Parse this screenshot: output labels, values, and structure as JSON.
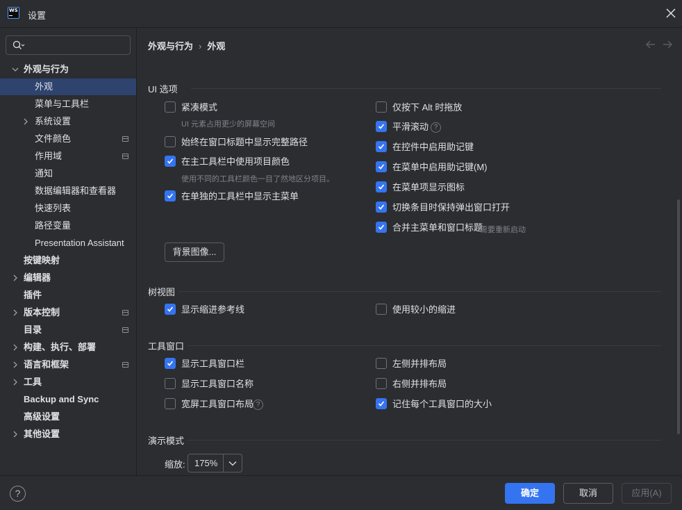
{
  "window": {
    "title": "设置",
    "logo_text": "WS"
  },
  "search": {
    "placeholder": ""
  },
  "sidebar": {
    "items": [
      {
        "label": "外观与行为",
        "bold": true,
        "expanded": true,
        "level": 0
      },
      {
        "label": "外观",
        "level": 1,
        "selected": true
      },
      {
        "label": "菜单与工具栏",
        "level": 1
      },
      {
        "label": "系统设置",
        "level": 1,
        "collapsible": true
      },
      {
        "label": "文件颜色",
        "level": 1,
        "project_icon": true
      },
      {
        "label": "作用域",
        "level": 1,
        "project_icon": true
      },
      {
        "label": "通知",
        "level": 1
      },
      {
        "label": "数据编辑器和查看器",
        "level": 1
      },
      {
        "label": "快速列表",
        "level": 1
      },
      {
        "label": "路径变量",
        "level": 1
      },
      {
        "label": "Presentation Assistant",
        "level": 1
      },
      {
        "label": "按键映射",
        "bold": true,
        "level": 0
      },
      {
        "label": "编辑器",
        "bold": true,
        "level": 0,
        "collapsible": true
      },
      {
        "label": "插件",
        "bold": true,
        "level": 0
      },
      {
        "label": "版本控制",
        "bold": true,
        "level": 0,
        "collapsible": true,
        "project_icon": true
      },
      {
        "label": "目录",
        "bold": true,
        "level": 0,
        "project_icon": true
      },
      {
        "label": "构建、执行、部署",
        "bold": true,
        "level": 0,
        "collapsible": true
      },
      {
        "label": "语言和框架",
        "bold": true,
        "level": 0,
        "collapsible": true,
        "project_icon": true
      },
      {
        "label": "工具",
        "bold": true,
        "level": 0,
        "collapsible": true
      },
      {
        "label": "Backup and Sync",
        "bold": true,
        "level": 0
      },
      {
        "label": "高级设置",
        "bold": true,
        "level": 0
      },
      {
        "label": "其他设置",
        "bold": true,
        "level": 0,
        "collapsible": true
      }
    ]
  },
  "breadcrumb": {
    "parent": "外观与行为",
    "separator": "›",
    "current": "外观"
  },
  "sections": {
    "ui_options": {
      "title": "UI 选项",
      "compact_mode": {
        "label": "紧凑模式",
        "checked": false,
        "hint": "UI 元素占用更少的屏幕空间"
      },
      "full_path_title": {
        "label": "始终在窗口标题中显示完整路径",
        "checked": false
      },
      "project_colors": {
        "label": "在主工具栏中使用项目颜色",
        "checked": true,
        "hint": "使用不同的工具栏颜色一目了然地区分项目。"
      },
      "separate_main_menu": {
        "label": "在单独的工具栏中显示主菜单",
        "checked": true
      },
      "alt_drag": {
        "label": "仅按下 Alt 时拖放",
        "checked": false
      },
      "smooth_scroll": {
        "label": "平滑滚动",
        "checked": true
      },
      "mnemonics_controls": {
        "label": "在控件中启用助记键",
        "checked": true
      },
      "mnemonics_menu": {
        "label": "在菜单中启用助记键(M)",
        "checked": true
      },
      "menu_icons": {
        "label": "在菜单项显示图标",
        "checked": true
      },
      "keep_popup": {
        "label": "切换条目时保持弹出窗口打开",
        "checked": true
      },
      "merge_menu": {
        "label": "合并主菜单和窗口标题",
        "checked": true,
        "hint": "需要重新启动"
      },
      "background_button": "背景图像..."
    },
    "tree_view": {
      "title": "树视图",
      "indent_guides": {
        "label": "显示缩进参考线",
        "checked": true
      },
      "smaller_indent": {
        "label": "使用较小的缩进",
        "checked": false
      }
    },
    "tool_windows": {
      "title": "工具窗口",
      "show_bar": {
        "label": "显示工具窗口栏",
        "checked": true
      },
      "show_names": {
        "label": "显示工具窗口名称",
        "checked": false
      },
      "widescreen": {
        "label": "宽屏工具窗口布局",
        "checked": false
      },
      "left_side": {
        "label": "左侧并排布局",
        "checked": false
      },
      "right_side": {
        "label": "右侧并排布局",
        "checked": false
      },
      "remember_size": {
        "label": "记住每个工具窗口的大小",
        "checked": true
      }
    },
    "presentation": {
      "title": "演示模式",
      "zoom_label": "缩放:",
      "zoom_value": "175%"
    }
  },
  "footer": {
    "ok": "确定",
    "cancel": "取消",
    "apply": "应用(A)",
    "help": "?"
  },
  "colors": {
    "accent": "#3574f0",
    "background": "#2b2d30",
    "selection": "#2e436e"
  }
}
